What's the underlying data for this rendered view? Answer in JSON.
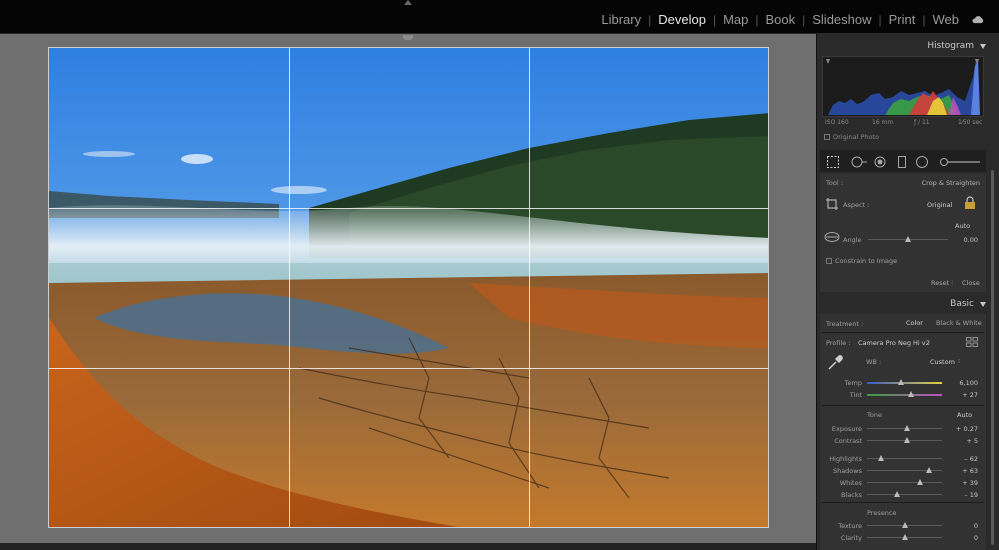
{
  "modules": {
    "items": [
      "Library",
      "Develop",
      "Map",
      "Book",
      "Slideshow",
      "Print",
      "Web"
    ],
    "active": "Develop"
  },
  "histogram": {
    "title": "Histogram",
    "iso": "ISO 160",
    "focal": "16 mm",
    "aperture": "ƒ / 11",
    "shutter": "1⁄50 sec",
    "original_photo": "Original Photo"
  },
  "crop": {
    "tool_label": "Tool :",
    "tool_value": "Crop & Straighten",
    "aspect_label": "Aspect :",
    "aspect_value": "Original",
    "auto_label": "Auto",
    "angle_label": "Angle",
    "angle_value": "0.00",
    "angle_level": 0.5,
    "constrain_label": "Constrain to Image",
    "reset_label": "Reset",
    "close_label": "Close"
  },
  "basic": {
    "title": "Basic",
    "treatment_label": "Treatment :",
    "color_label": "Color",
    "bw_label": "Black & White",
    "profile_label": "Profile :",
    "profile_value": "Camera Pro Neg Hi v2",
    "wb_label": "WB :",
    "wb_value": "Custom",
    "tone_label": "Tone",
    "tone_auto": "Auto",
    "presence_label": "Presence",
    "sliders": [
      {
        "key": "temp",
        "label": "Temp",
        "value": "6,100",
        "level": 0.45
      },
      {
        "key": "tint",
        "label": "Tint",
        "value": "+ 27",
        "level": 0.59
      },
      {
        "key": "exposure",
        "label": "Exposure",
        "value": "+ 0.27",
        "level": 0.53
      },
      {
        "key": "contrast",
        "label": "Contrast",
        "value": "+ 5",
        "level": 0.53
      },
      {
        "key": "highlights",
        "label": "Highlights",
        "value": "– 62",
        "level": 0.19
      },
      {
        "key": "shadows",
        "label": "Shadows",
        "value": "+ 63",
        "level": 0.82
      },
      {
        "key": "whites",
        "label": "Whites",
        "value": "+ 39",
        "level": 0.7
      },
      {
        "key": "blacks",
        "label": "Blacks",
        "value": "– 19",
        "level": 0.4
      },
      {
        "key": "texture",
        "label": "Texture",
        "value": "0",
        "level": 0.5
      },
      {
        "key": "clarity",
        "label": "Clarity",
        "value": "0",
        "level": 0.5
      }
    ]
  },
  "colors": {
    "accent": "#e6e6e6",
    "panel": "#2a2a2a",
    "canvas": "#6f6f6f"
  }
}
